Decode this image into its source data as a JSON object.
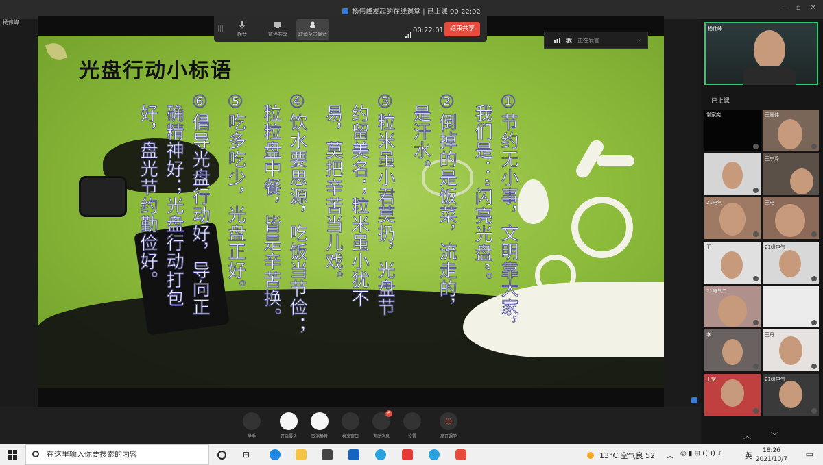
{
  "window": {
    "title": "杨伟峰发起的在线课堂 | 已上课 00:22:02",
    "host_label": "杨伟峰"
  },
  "share_toolbar": {
    "buttons": [
      {
        "label": "静音"
      },
      {
        "label": "暂停共享"
      },
      {
        "label": "取消全员静音"
      }
    ],
    "timer": "00:22:01",
    "stop_label": "结束共享"
  },
  "speaking_indicator": {
    "me": "我",
    "status": "正在发言"
  },
  "slide": {
    "title": "光盘行动小标语",
    "columns": [
      "①节约无小事，文明靠大家，",
      "我们是：“闪亮光盘”。",
      "②倒掉的是饭菜，流走的，",
      "是汗水。",
      "③粒米虽小君莫扔，光盘节",
      "约留美名；粒米虽小犹不",
      "易，莫把辛苦当儿戏。",
      "④饮水要思源，吃饭当节俭；",
      "粒粒盘中餐，皆是辛苦换。",
      "⑤吃多吃少，光盘正好。",
      "⑥倡导光盘行动好，导向正",
      "确精神好；光盘行动打包",
      "好，盘光节约勤俭好。"
    ]
  },
  "bottom_toolbar": {
    "buttons": [
      {
        "label": "举手"
      },
      {
        "label": "开启摄头"
      },
      {
        "label": "取消静音"
      },
      {
        "label": "共享窗口"
      },
      {
        "label": "互动消息",
        "badge": "6"
      },
      {
        "label": "设置"
      },
      {
        "label": "离开课堂"
      }
    ]
  },
  "participants_panel": {
    "self_name": "杨伟峰",
    "status": "已上课",
    "tiles": [
      {
        "name": "常家奕"
      },
      {
        "name": "王嘉伟"
      },
      {
        "name": ""
      },
      {
        "name": "王宁泽"
      },
      {
        "name": "21电气"
      },
      {
        "name": "王电"
      },
      {
        "name": "王"
      },
      {
        "name": "21级电气"
      },
      {
        "name": "21电气二"
      },
      {
        "name": ""
      },
      {
        "name": "李"
      },
      {
        "name": "王丹"
      },
      {
        "name": "王宝"
      },
      {
        "name": "21级电气"
      }
    ]
  },
  "taskbar": {
    "search_placeholder": "在这里输入你要搜索的内容",
    "weather": "13°C 空气良 52",
    "ime": "英",
    "time": "18:26",
    "date": "2021/10/7"
  }
}
